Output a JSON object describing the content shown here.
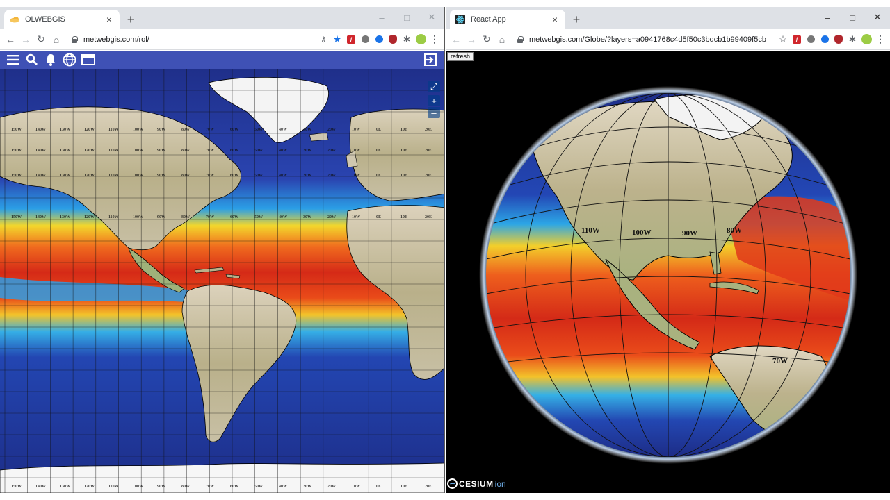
{
  "left_window": {
    "tab_title": "OLWEBGIS",
    "url": "metwebgis.com/rol/",
    "window_controls": {
      "minimize": "–",
      "maximize": "□",
      "close": "✕"
    },
    "app_toolbar_icons": [
      "menu-icon",
      "search-icon",
      "bell-icon",
      "globe-icon",
      "window-icon",
      "logout-icon"
    ],
    "map_controls": {
      "fullscreen": "⤢",
      "zoom_in": "+",
      "zoom_out": "–"
    },
    "longitude_labels": [
      "150W",
      "140W",
      "130W",
      "120W",
      "110W",
      "100W",
      "90W",
      "80W",
      "70W",
      "60W",
      "50W",
      "40W",
      "30W",
      "20W",
      "10W",
      "0E",
      "10E",
      "20E"
    ]
  },
  "right_window": {
    "tab_title": "React App",
    "url": "metwebgis.com/Globe/?layers=a0941768c4d5f50c3bdcb1b99409f5cb",
    "window_controls": {
      "minimize": "–",
      "maximize": "□",
      "close": "✕"
    },
    "refresh_label": "refresh",
    "attribution": {
      "brand": "CESIUM",
      "product": "ion"
    },
    "globe_labels": [
      "100W",
      "90W",
      "80W",
      "110W",
      "70W"
    ]
  },
  "colors": {
    "app_bar": "#3f51b5",
    "ocean_cold": "#21318f",
    "ocean_mid": "#29a7e8",
    "ocean_warm": "#d62b17",
    "land": "#c9b99a"
  }
}
